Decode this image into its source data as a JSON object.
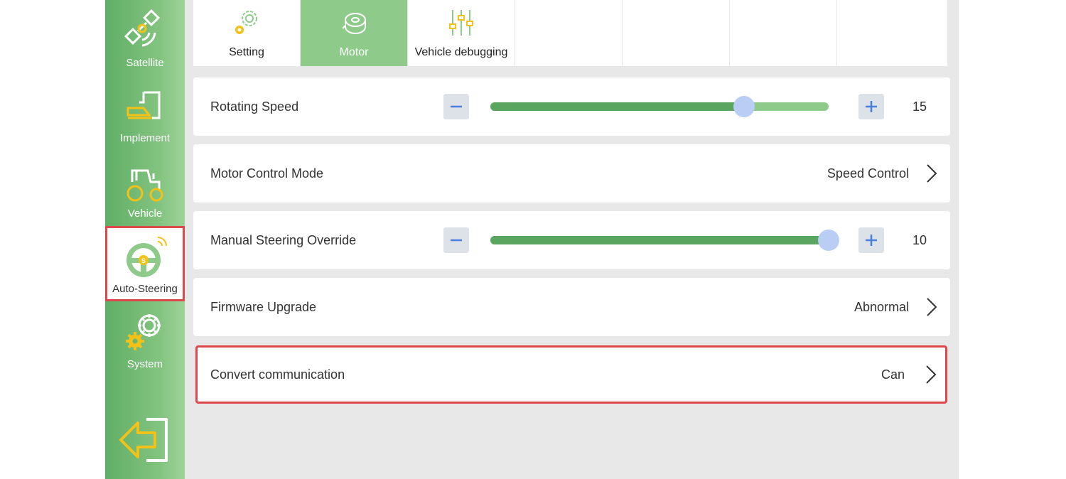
{
  "sidebar": {
    "items": [
      {
        "label": "Satellite",
        "icon": "satellite-icon",
        "active": false
      },
      {
        "label": "Implement",
        "icon": "implement-icon",
        "active": false
      },
      {
        "label": "Vehicle",
        "icon": "tractor-icon",
        "active": false
      },
      {
        "label": "Auto-Steering",
        "icon": "steering-wheel-icon",
        "active": true
      },
      {
        "label": "System",
        "icon": "gear-icon",
        "active": false
      }
    ],
    "back_icon": "back-arrow-icon"
  },
  "tabs": [
    {
      "label": "Setting",
      "icon": "gear-icon",
      "active": false
    },
    {
      "label": "Motor",
      "icon": "motor-icon",
      "active": true
    },
    {
      "label": "Vehicle debugging",
      "icon": "sliders-icon",
      "active": false
    }
  ],
  "settings": {
    "rotating_speed": {
      "label": "Rotating Speed",
      "value": "15",
      "level": 0.75
    },
    "motor_control_mode": {
      "label": "Motor Control Mode",
      "value": "Speed Control"
    },
    "manual_steering_override": {
      "label": "Manual Steering Override",
      "value": "10",
      "level": 1.0
    },
    "firmware_upgrade": {
      "label": "Firmware Upgrade",
      "value": "Abnormal"
    },
    "convert_communication": {
      "label": "Convert communication",
      "value": "Can"
    }
  },
  "colors": {
    "sidebar_green": "#6db56f",
    "accent_green": "#8ecb8a",
    "fill_green": "#5aa55f",
    "highlight_red": "#e0474c",
    "icon_yellow": "#f2c218",
    "slider_thumb": "#b9cdf5",
    "stepper_blue": "#4a7fe0"
  }
}
